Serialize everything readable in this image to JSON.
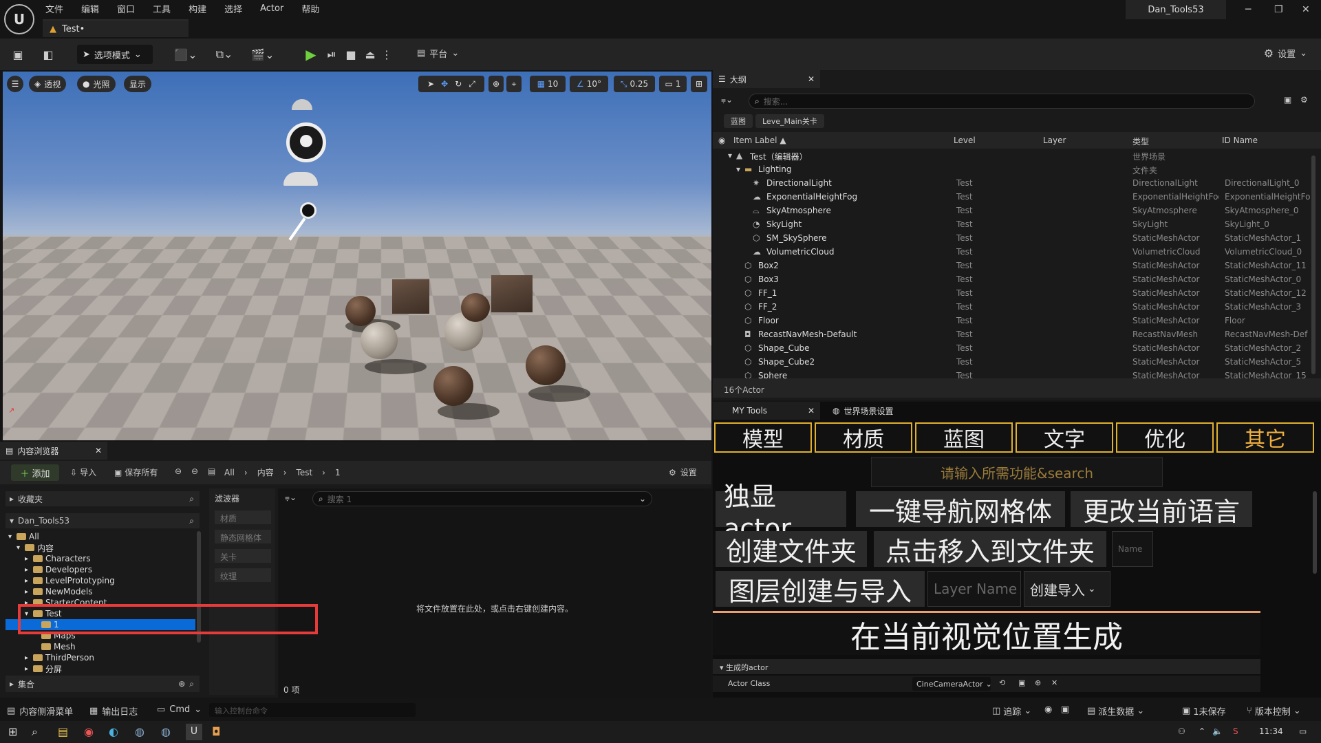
{
  "app": {
    "menu": [
      "文件",
      "编辑",
      "窗口",
      "工具",
      "构建",
      "选择",
      "Actor",
      "帮助"
    ],
    "doc_tab": "Test•",
    "project_name": "Dan_Tools53"
  },
  "toolbar": {
    "mode_label": "选项模式",
    "platform_label": "平台",
    "settings_label": "设置"
  },
  "viewport": {
    "perspective": "透视",
    "lighting": "光照",
    "show": "显示",
    "grid_snap": "10",
    "angle_snap": "10°",
    "scale_snap": "0.25",
    "camera_speed": "1"
  },
  "outliner": {
    "tab_label": "大纲",
    "search_placeholder": "搜索...",
    "chips": [
      "蓝图",
      "Leve_Main关卡"
    ],
    "columns": [
      "Item Label ▲",
      "Level",
      "Layer",
      "类型",
      "ID Name"
    ],
    "rows": [
      {
        "indent": 0,
        "icon": "level-icon",
        "label": "Test（编辑器）",
        "level": "",
        "type": "世界场景",
        "id": ""
      },
      {
        "indent": 1,
        "icon": "folder-icon",
        "label": "Lighting",
        "level": "",
        "type": "文件夹",
        "id": ""
      },
      {
        "indent": 2,
        "icon": "directional-light-icon",
        "label": "DirectionalLight",
        "level": "Test",
        "type": "DirectionalLight",
        "id": "DirectionalLight_0"
      },
      {
        "indent": 2,
        "icon": "fog-icon",
        "label": "ExponentialHeightFog",
        "level": "Test",
        "type": "ExponentialHeightFog",
        "id": "ExponentialHeightFog"
      },
      {
        "indent": 2,
        "icon": "sky-atmosphere-icon",
        "label": "SkyAtmosphere",
        "level": "Test",
        "type": "SkyAtmosphere",
        "id": "SkyAtmosphere_0"
      },
      {
        "indent": 2,
        "icon": "sky-light-icon",
        "label": "SkyLight",
        "level": "Test",
        "type": "SkyLight",
        "id": "SkyLight_0"
      },
      {
        "indent": 2,
        "icon": "mesh-icon",
        "label": "SM_SkySphere",
        "level": "Test",
        "type": "StaticMeshActor",
        "id": "StaticMeshActor_1"
      },
      {
        "indent": 2,
        "icon": "cloud-icon",
        "label": "VolumetricCloud",
        "level": "Test",
        "type": "VolumetricCloud",
        "id": "VolumetricCloud_0"
      },
      {
        "indent": 1,
        "icon": "mesh-icon",
        "label": "Box2",
        "level": "Test",
        "type": "StaticMeshActor",
        "id": "StaticMeshActor_11"
      },
      {
        "indent": 1,
        "icon": "mesh-icon",
        "label": "Box3",
        "level": "Test",
        "type": "StaticMeshActor",
        "id": "StaticMeshActor_0"
      },
      {
        "indent": 1,
        "icon": "mesh-icon",
        "label": "FF_1",
        "level": "Test",
        "type": "StaticMeshActor",
        "id": "StaticMeshActor_12"
      },
      {
        "indent": 1,
        "icon": "mesh-icon",
        "label": "FF_2",
        "level": "Test",
        "type": "StaticMeshActor",
        "id": "StaticMeshActor_3"
      },
      {
        "indent": 1,
        "icon": "mesh-icon",
        "label": "Floor",
        "level": "Test",
        "type": "StaticMeshActor",
        "id": "Floor"
      },
      {
        "indent": 1,
        "icon": "navmesh-icon",
        "label": "RecastNavMesh-Default",
        "level": "Test",
        "type": "RecastNavMesh",
        "id": "RecastNavMesh-Def"
      },
      {
        "indent": 1,
        "icon": "mesh-icon",
        "label": "Shape_Cube",
        "level": "Test",
        "type": "StaticMeshActor",
        "id": "StaticMeshActor_2"
      },
      {
        "indent": 1,
        "icon": "mesh-icon",
        "label": "Shape_Cube2",
        "level": "Test",
        "type": "StaticMeshActor",
        "id": "StaticMeshActor_5"
      },
      {
        "indent": 1,
        "icon": "mesh-icon",
        "label": "Sphere",
        "level": "Test",
        "type": "StaticMeshActor",
        "id": "StaticMeshActor_15"
      }
    ],
    "footer": "16个Actor"
  },
  "mytools": {
    "tab_label": "MY Tools",
    "tab2_label": "世界场景设置",
    "categories": [
      "模型",
      "材质",
      "蓝图",
      "文字",
      "优化",
      "其它"
    ],
    "search_text": "请输入所需功能&search",
    "buttons": {
      "isolate": "独显actor",
      "navmesh": "一键导航网格体",
      "language": "更改当前语言",
      "create_folder": "创建文件夹",
      "move_to_folder": "点击移入到文件夹",
      "name_placeholder": "Name",
      "layer_create": "图层创建与导入",
      "layer_placeholder": "Layer Name",
      "create_import": "创建导入"
    },
    "spawn_label": "在当前视觉位置生成",
    "gen_section": "生成的actor",
    "actor_class_label": "Actor Class",
    "actor_class_value": "CineCameraActor"
  },
  "content_browser": {
    "tab_label": "内容浏览器",
    "add": "添加",
    "import": "导入",
    "save_all": "保存所有",
    "breadcrumb": [
      "All",
      "内容",
      "Test",
      "1"
    ],
    "settings": "设置",
    "favorites": "收藏夹",
    "project": "Dan_Tools53",
    "tree": [
      {
        "indent": 0,
        "label": "All",
        "open": true
      },
      {
        "indent": 1,
        "label": "内容",
        "open": true
      },
      {
        "indent": 2,
        "label": "Characters",
        "open": false
      },
      {
        "indent": 2,
        "label": "Developers",
        "open": false
      },
      {
        "indent": 2,
        "label": "LevelPrototyping",
        "open": false
      },
      {
        "indent": 2,
        "label": "NewModels",
        "open": false
      },
      {
        "indent": 2,
        "label": "StarterContent",
        "open": false
      },
      {
        "indent": 2,
        "label": "Test",
        "open": true
      },
      {
        "indent": 3,
        "label": "1",
        "open": false,
        "selected": true
      },
      {
        "indent": 3,
        "label": "Maps",
        "open": false
      },
      {
        "indent": 3,
        "label": "Mesh",
        "open": false
      },
      {
        "indent": 2,
        "label": "ThirdPerson",
        "open": false
      },
      {
        "indent": 2,
        "label": "分屏",
        "open": false
      }
    ],
    "collections": "集合",
    "filters_title": "滤波器",
    "filters": [
      "材质",
      "静态网格体",
      "关卡",
      "纹理"
    ],
    "search_placeholder": "搜索 1",
    "empty_message": "将文件放置在此处，或点击右键创建内容。",
    "item_count": "0 项"
  },
  "statusbar": {
    "drawer": "内容侧滑菜单",
    "output_log": "输出日志",
    "cmd": "Cmd",
    "console_placeholder": "输入控制台命令",
    "trace": "追踪",
    "derived_data": "派生数据",
    "unsaved": "1未保存",
    "source_control": "版本控制"
  },
  "taskbar": {
    "time": "11:34"
  }
}
